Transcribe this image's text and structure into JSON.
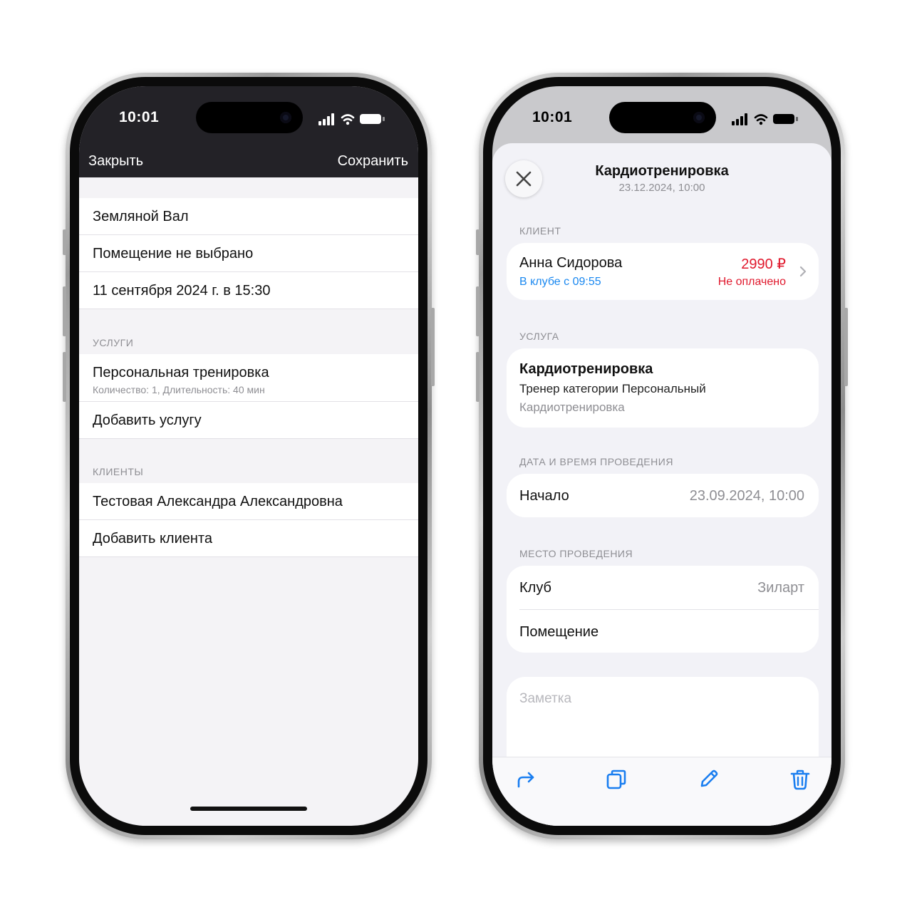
{
  "left_phone": {
    "status": {
      "time": "10:01"
    },
    "nav": {
      "close_label": "Закрыть",
      "save_label": "Сохранить"
    },
    "rows": {
      "location": "Земляной Вал",
      "room": "Помещение не выбрано",
      "datetime": "11 сентября 2024 г. в 15:30"
    },
    "services": {
      "header": "УСЛУГИ",
      "item_title": "Персональная тренировка",
      "item_subtitle": "Количество: 1, Длительность: 40 мин",
      "add_label": "Добавить услугу"
    },
    "clients": {
      "header": "КЛИЕНТЫ",
      "item_name": "Тестовая Александра Александровна",
      "add_label": "Добавить клиента"
    }
  },
  "right_phone": {
    "status": {
      "time": "10:01"
    },
    "header": {
      "title": "Кардиотренировка",
      "subtitle": "23.12.2024, 10:00"
    },
    "client": {
      "header": "КЛИЕНТ",
      "name": "Анна Сидорова",
      "status": "В клубе с 09:55",
      "price": "2990 ₽",
      "payment": "Не оплачено"
    },
    "service": {
      "header": "УСЛУГА",
      "title": "Кардиотренировка",
      "line1": "Тренер категории Персональный",
      "line2": "Кардиотренировка"
    },
    "datetime": {
      "header": "ДАТА И ВРЕМЯ ПРОВЕДЕНИЯ",
      "start_label": "Начало",
      "start_value": "23.09.2024, 10:00"
    },
    "place": {
      "header": "МЕСТО ПРОВЕДЕНИЯ",
      "club_label": "Клуб",
      "club_value": "Зиларт",
      "room_label": "Помещение"
    },
    "note": {
      "placeholder": "Заметка"
    },
    "toolbar": {
      "icons": [
        "share-icon",
        "copy-icon",
        "edit-icon",
        "trash-icon"
      ]
    },
    "colors": {
      "accent": "#1a7ef0",
      "price": "#e0182c",
      "status_blue": "#1a88f0"
    }
  }
}
